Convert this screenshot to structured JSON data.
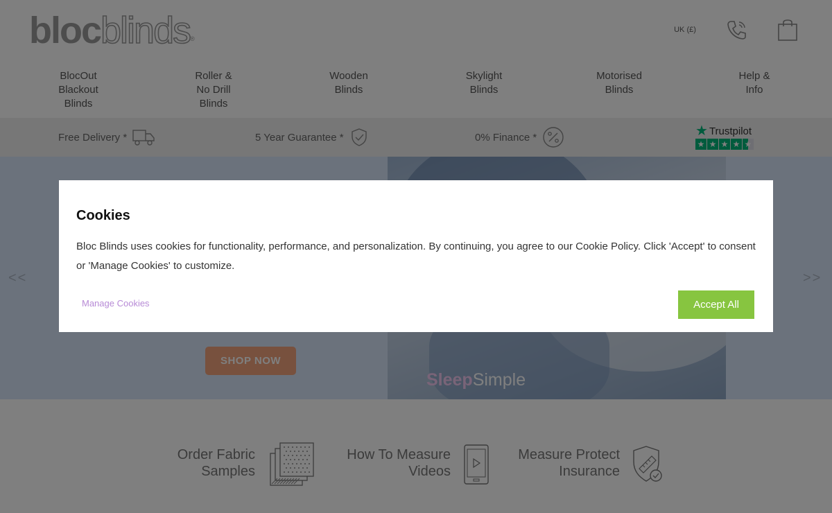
{
  "header": {
    "logo_bold": "bloc",
    "logo_light": "blinds",
    "logo_reg": "®",
    "currency": "UK (£)",
    "phone_icon": "phone-icon",
    "bag_icon": "shopping-bag-icon"
  },
  "nav": {
    "items": [
      {
        "label": "BlocOut\nBlackout\nBlinds"
      },
      {
        "label": "Roller &\nNo Drill\nBlinds"
      },
      {
        "label": "Wooden\nBlinds"
      },
      {
        "label": "Skylight\nBlinds"
      },
      {
        "label": "Motorised\nBlinds"
      },
      {
        "label": "Help &\nInfo"
      }
    ]
  },
  "usp": {
    "delivery": "Free Delivery *",
    "guarantee": "5 Year Guarantee *",
    "finance": "0% Finance *",
    "trustpilot": "Trustpilot",
    "rating_stars": 4.5
  },
  "hero": {
    "prev": "<<",
    "next": ">>",
    "shop_now": "SHOP NOW",
    "brand_bold": "Sleep",
    "brand_light": "Simple"
  },
  "features": {
    "samples": "Order Fabric\nSamples",
    "measure": "How To Measure\nVideos",
    "insurance": "Measure Protect\nInsurance"
  },
  "cookie_modal": {
    "title": "Cookies",
    "text": "Bloc Blinds uses cookies for functionality, performance, and personalization. By continuing, you agree to our Cookie Policy. Click 'Accept' to consent or 'Manage Cookies' to customize.",
    "manage_label": "Manage Cookies",
    "accept_label": "Accept All"
  },
  "colors": {
    "accept_green": "#87c540",
    "manage_purple": "#b78ad6",
    "trustpilot_green": "#00b67a",
    "shop_now_orange": "#f0a27c"
  }
}
